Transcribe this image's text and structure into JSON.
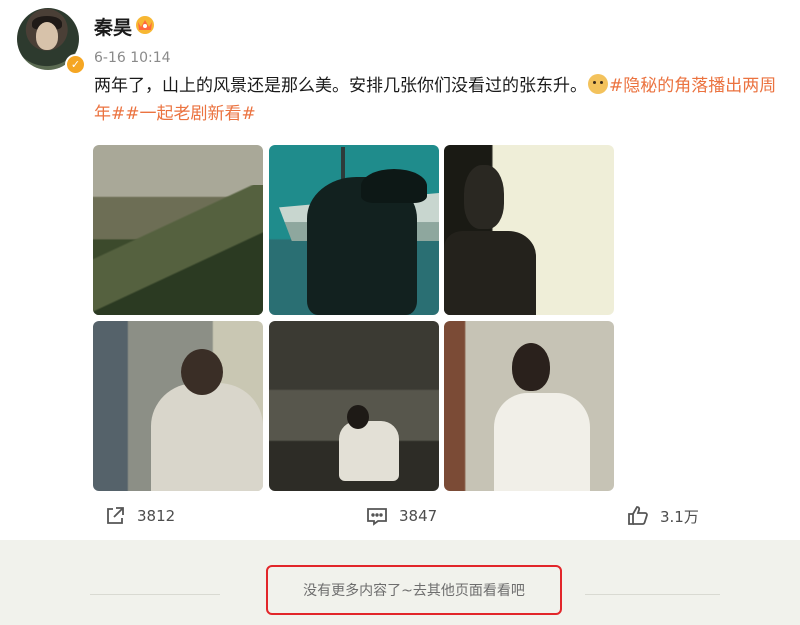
{
  "post": {
    "username": "秦昊",
    "time": "6-16 10:14",
    "text_part1": "两年了，山上的风景还是那么美。安排几张你们没看过的张东升。",
    "hashtag_part": "#隐秘的角落播出两周年##一起老剧新看#",
    "verified_icon": "verified-badge-icon",
    "vip_icon": "crown-vip-icon",
    "emoji": "doge-emoji"
  },
  "photos": [
    {
      "name": "mountain-landscape"
    },
    {
      "name": "man-with-cap-by-ship"
    },
    {
      "name": "man-silhouette-window"
    },
    {
      "name": "man-writing-on-wall"
    },
    {
      "name": "man-sitting-dark-room"
    },
    {
      "name": "man-white-shirt-classroom"
    }
  ],
  "actions": {
    "share_count": "3812",
    "comment_count": "3847",
    "like_count": "3.1万"
  },
  "footer": {
    "no_more_text": "没有更多内容了~去其他页面看看吧"
  },
  "colors": {
    "hashtag": "#eb7340",
    "highlight_border": "#e2262a",
    "footer_bg": "#f1f2ec"
  }
}
